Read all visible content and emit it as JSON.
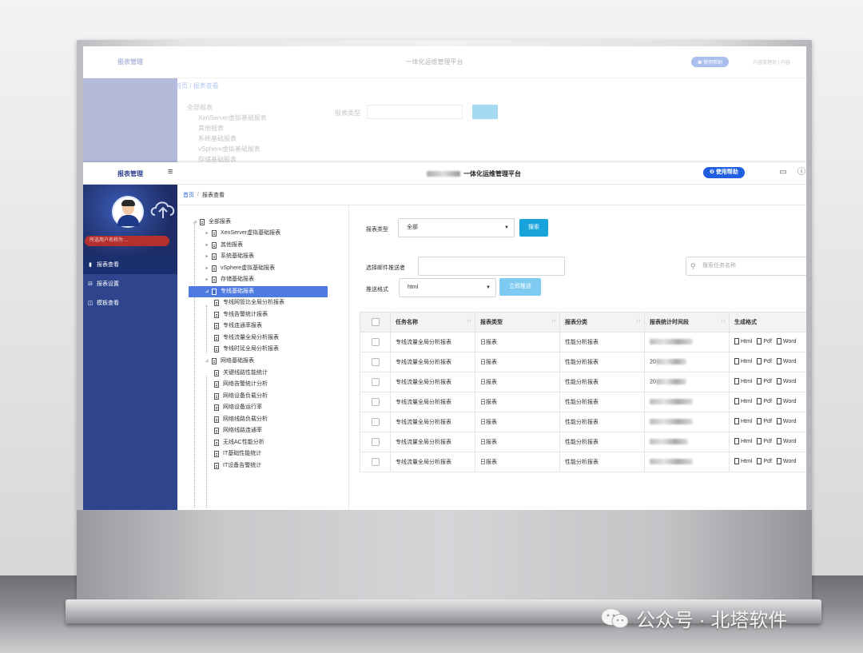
{
  "app": {
    "logo": "报表管理",
    "platform_title": "一体化运维管理平台",
    "help_button": "❷ 使用帮助",
    "ghost_help_button": "❷ 使用帮助",
    "ghost_user": "内容管理员 | 内容"
  },
  "sidebar": {
    "user_label": "所选用户名称为 ...",
    "items": [
      {
        "icon": "report-view-icon",
        "label": "报表查看",
        "active": true
      },
      {
        "icon": "report-settings-icon",
        "label": "报表设置",
        "active": false
      },
      {
        "icon": "template-view-icon",
        "label": "模板查看",
        "active": false
      }
    ]
  },
  "breadcrumb": {
    "home": "首页",
    "separator": "/",
    "current": "报表查看"
  },
  "tree": {
    "root": "全部报表",
    "groups": [
      {
        "label": "XenServer虚拟基础报表"
      },
      {
        "label": "其他报表"
      },
      {
        "label": "系统基础报表"
      },
      {
        "label": "vSphere虚拟基础报表"
      },
      {
        "label": "存储基础报表"
      },
      {
        "label": "专线基础报表",
        "selected": true,
        "children": [
          "专线网管比全局分析报表",
          "专线告警统计报表",
          "专线连通率报表",
          "专线流量全局分析报表",
          "专线时延全局分析报表"
        ]
      },
      {
        "label": "网络基础报表",
        "children": [
          "关键线路性能统计",
          "网络告警统计分析",
          "网络设备负载分析",
          "网络设备运行率",
          "网络线路负载分析",
          "网络线路连通率",
          "无线AC性能分析",
          "IT基础性能统计",
          "IT设备告警统计"
        ]
      }
    ]
  },
  "filters": {
    "report_type_label": "报表类型",
    "report_type_value": "全部",
    "search_button": "搜索",
    "sender_label": "选择邮件推送者",
    "sender_value": "",
    "format_label": "推送格式",
    "format_value": "html",
    "send_button": "立即推送",
    "task_search_placeholder": "搜索任务名称"
  },
  "table": {
    "columns": [
      "任务名称",
      "报表类型",
      "报表分类",
      "报表统计时间段",
      "生成格式"
    ],
    "formats": [
      "Html",
      "Pdf",
      "Word"
    ],
    "rows": [
      {
        "name": "专线流量全局分析报表",
        "type": "日报表",
        "category": "性能分析报表",
        "period": ""
      },
      {
        "name": "专线流量全局分析报表",
        "type": "日报表",
        "category": "性能分析报表",
        "period": "20"
      },
      {
        "name": "专线流量全局分析报表",
        "type": "日报表",
        "category": "性能分析报表",
        "period": "20"
      },
      {
        "name": "专线流量全局分析报表",
        "type": "日报表",
        "category": "性能分析报表",
        "period": ""
      },
      {
        "name": "专线流量全局分析报表",
        "type": "日报表",
        "category": "性能分析报表",
        "period": ""
      },
      {
        "name": "专线流量全局分析报表",
        "type": "日报表",
        "category": "性能分析报表",
        "period": ""
      },
      {
        "name": "专线流量全局分析报表",
        "type": "日报表",
        "category": "性能分析报表",
        "period": ""
      }
    ]
  },
  "watermark": "公众号 · 北塔软件",
  "colors": {
    "sidebar": "#2e448c",
    "accent": "#19a3db",
    "help": "#1f5fe0",
    "tree_selected": "#4f7be0"
  }
}
